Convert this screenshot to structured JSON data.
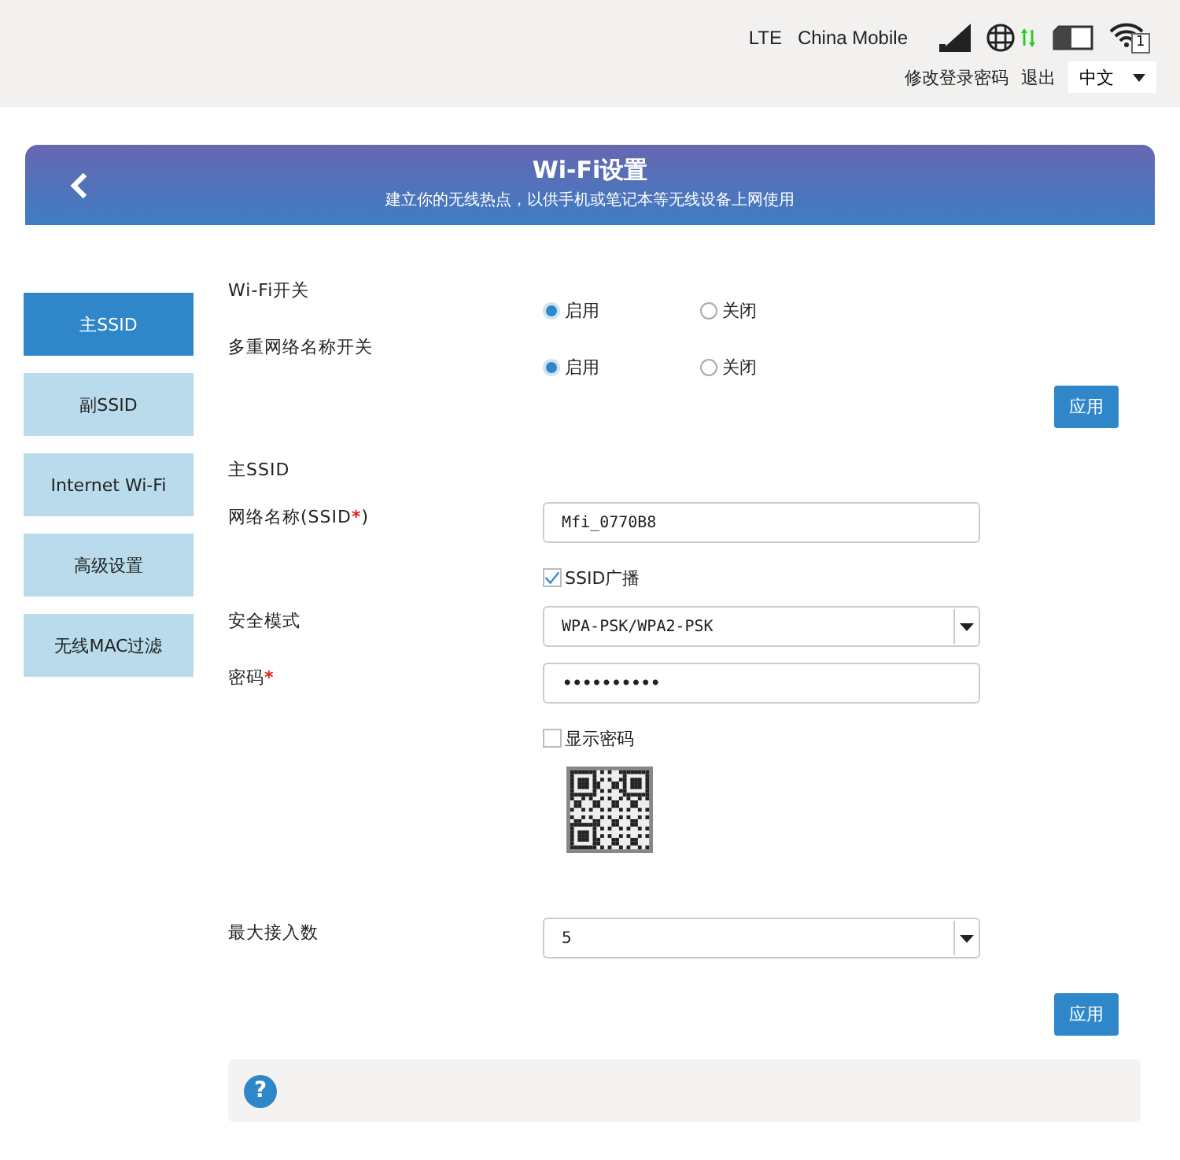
{
  "status_bar": {
    "network_type": "LTE",
    "operator": "China Mobile",
    "wifi_clients": "1"
  },
  "header_links": [
    {
      "label": "修改登录密码"
    },
    {
      "label": "退出"
    }
  ],
  "language": {
    "value": "中文"
  },
  "banner": {
    "title": "Wi-Fi设置",
    "subtitle": "建立你的无线热点，以供手机或笔记本等无线设备上网使用"
  },
  "sidebar": {
    "items": [
      {
        "label": "主SSID",
        "selected": true
      },
      {
        "label": "副SSID",
        "selected": false
      },
      {
        "label": "Internet Wi-Fi",
        "selected": false
      },
      {
        "label": "高级设置",
        "selected": false
      },
      {
        "label": "无线MAC过滤",
        "selected": false
      }
    ]
  },
  "switches": [
    {
      "label": "Wi-Fi开关",
      "options": [
        {
          "label": "启用",
          "selected": true
        },
        {
          "label": "关闭",
          "selected": false
        }
      ]
    },
    {
      "label": "多重网络名称开关",
      "options": [
        {
          "label": "启用",
          "selected": true
        },
        {
          "label": "关闭",
          "selected": false
        }
      ]
    }
  ],
  "apply_button_1": "应用",
  "section_title": "主SSID",
  "ssid": {
    "label": "网络名称(SSID",
    "required_mark": "*",
    "label_end": ")",
    "value": "Mfi_0770B8"
  },
  "ssid_broadcast": {
    "label": "SSID广播",
    "checked": true
  },
  "security_mode": {
    "label": "安全模式",
    "value": "WPA-PSK/WPA2-PSK"
  },
  "password": {
    "label": "密码",
    "required_mark": "*",
    "value": "••••••••••"
  },
  "show_password": {
    "label": "显示密码",
    "checked": false
  },
  "max_clients": {
    "label": "最大接入数",
    "value": "5"
  },
  "apply_button_2": "应用",
  "help": {
    "icon": "?"
  }
}
